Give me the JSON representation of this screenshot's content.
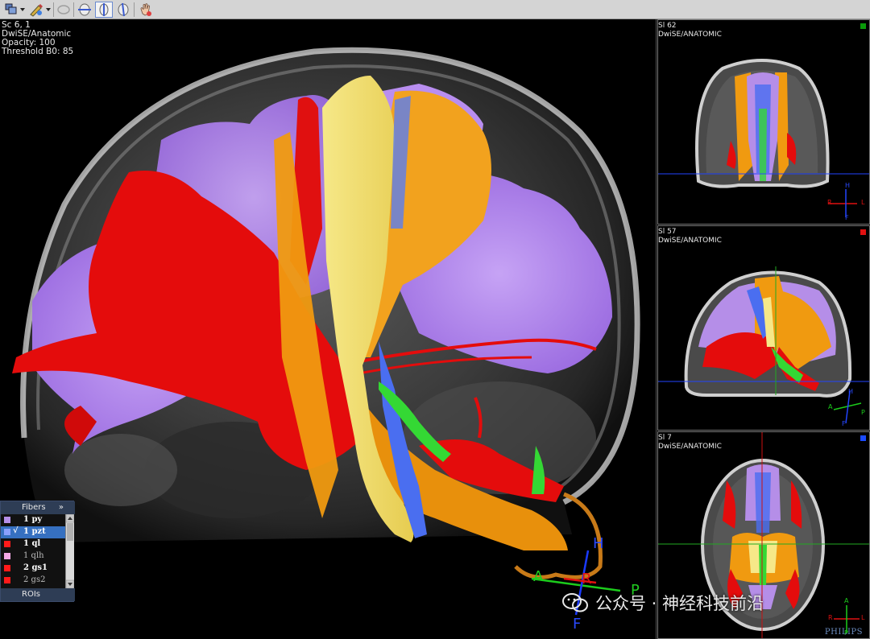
{
  "toolbar": {
    "buttons": [
      {
        "name": "layout-tool",
        "icon": "layout-icon"
      },
      {
        "name": "draw-tool",
        "icon": "pencil-icon"
      },
      {
        "name": "roi-ellipse-tool",
        "icon": "ellipse-icon"
      },
      {
        "name": "axial-orientation-tool",
        "icon": "head-axial-icon"
      },
      {
        "name": "sagittal-orientation-tool",
        "icon": "head-sagittal-icon"
      },
      {
        "name": "coronal-orientation-tool",
        "icon": "head-coronal-icon"
      },
      {
        "name": "pan-hand-tool",
        "icon": "hand-icon"
      }
    ]
  },
  "main_view": {
    "info": [
      "Sc 6, 1",
      "DwiSE/Anatomic",
      "Opacity: 100",
      "Threshold B0: 85"
    ],
    "orientation": {
      "H": "H",
      "A": "A",
      "R": "R",
      "P": "P",
      "F": "F"
    }
  },
  "fibers_panel": {
    "title": "Fibers",
    "expand_label": "»",
    "items": [
      {
        "label": "1 py",
        "color": "#b58ee8",
        "checked": false,
        "selected": false,
        "bold": true
      },
      {
        "label": "1 pzt",
        "color": "#8aa0ff",
        "checked": true,
        "selected": true,
        "bold": true
      },
      {
        "label": "1 ql",
        "color": "#ff1a1a",
        "checked": false,
        "selected": false,
        "bold": true
      },
      {
        "label": "1 qlh",
        "color": "#f3a8e6",
        "checked": false,
        "selected": false,
        "bold": false
      },
      {
        "label": "2 gs1",
        "color": "#ff1a1a",
        "checked": false,
        "selected": false,
        "bold": true
      },
      {
        "label": "2 gs2",
        "color": "#ff1a1a",
        "checked": false,
        "selected": false,
        "bold": false
      }
    ],
    "check_mark": "√",
    "rois_label": "ROIs"
  },
  "side_views": [
    {
      "slice": "Sl 62",
      "sequence": "DwiSE/ANATOMIC",
      "marker_color": "#0a9a0a",
      "plane": "coronal",
      "axes": [
        "H",
        "R",
        "L",
        "F"
      ]
    },
    {
      "slice": "Sl 57",
      "sequence": "DwiSE/ANATOMIC",
      "marker_color": "#e01010",
      "plane": "sagittal",
      "axes": [
        "H",
        "A",
        "P",
        "F"
      ]
    },
    {
      "slice": "Sl 7",
      "sequence": "DwiSE/ANATOMIC",
      "marker_color": "#1a4aff",
      "plane": "axial",
      "axes": [
        "A",
        "R",
        "L",
        "P"
      ]
    }
  ],
  "brand": "PHILIPS",
  "watermark": "公众号 · 神经科技前沿",
  "colors": {
    "purple": "#a877ea",
    "red": "#e40c0c",
    "yellow": "#f1e07a",
    "orange": "#f09a10",
    "blue": "#4a6ef0",
    "green": "#34d834"
  }
}
